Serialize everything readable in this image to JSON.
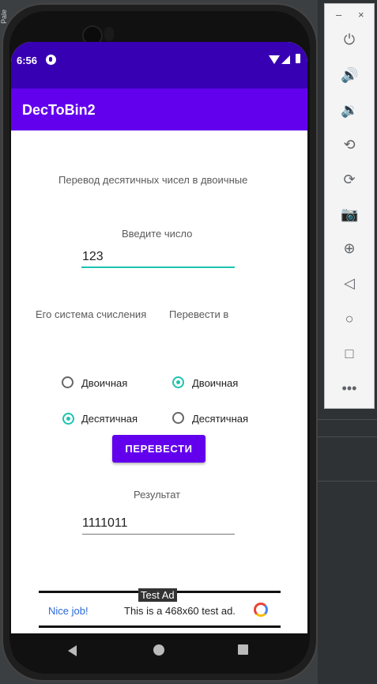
{
  "status": {
    "time": "6:56"
  },
  "app": {
    "title": "DecToBin2"
  },
  "main": {
    "heading": "Перевод десятичных чисел в двоичные",
    "input_label": "Введите число",
    "input_value": "123",
    "from_label": "Его система счисления",
    "to_label": "Перевести в",
    "from_options": [
      {
        "label": "Двоичная",
        "selected": false
      },
      {
        "label": "Десятичная",
        "selected": true
      }
    ],
    "to_options": [
      {
        "label": "Двоичная",
        "selected": true
      },
      {
        "label": "Десятичная",
        "selected": false
      }
    ],
    "convert_button": "ПЕРЕВЕСТИ",
    "result_label": "Результат",
    "result_value": "1111011"
  },
  "ad": {
    "badge": "Test Ad",
    "nice": "Nice job!",
    "text": "This is a 468x60 test ad."
  },
  "emulator_toolbar": {
    "minimize": "–",
    "close": "×"
  },
  "colors": {
    "status_bar": "#3700b3",
    "app_bar": "#6200ee",
    "accent": "#1ec3b0",
    "button": "#6200ee"
  }
}
